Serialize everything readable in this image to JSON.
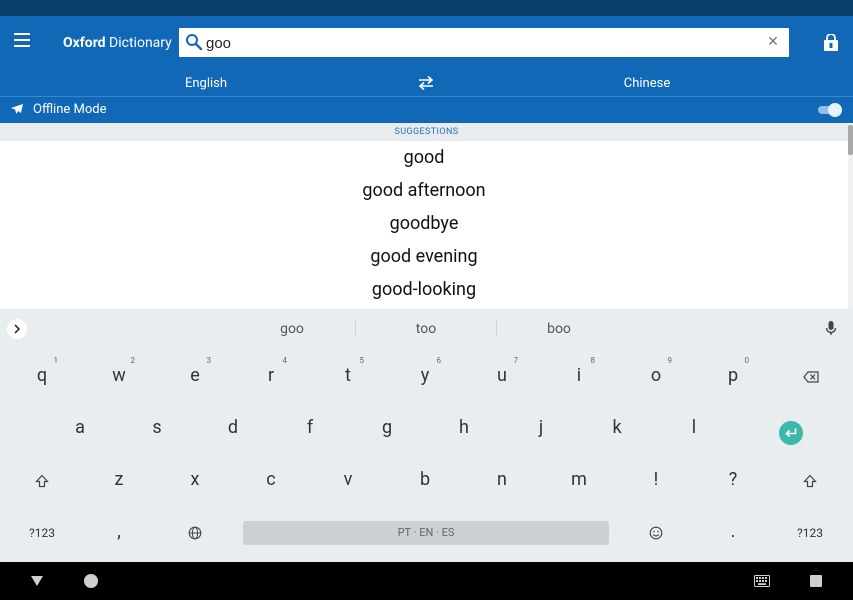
{
  "app": {
    "title_bold": "Oxford",
    "title_rest": " Dictionary"
  },
  "search": {
    "value": "goo",
    "placeholder": ""
  },
  "languages": {
    "source": "English",
    "target": "Chinese"
  },
  "offline": {
    "label": "Offline Mode",
    "enabled": true
  },
  "suggestions": {
    "header": "SUGGESTIONS",
    "items": [
      "good",
      "good afternoon",
      "goodbye",
      "good evening",
      "good-looking"
    ]
  },
  "keyboard": {
    "word_suggestions": [
      "goo",
      "too",
      "boo"
    ],
    "row1": [
      {
        "key": "q",
        "hint": "1"
      },
      {
        "key": "w",
        "hint": "2"
      },
      {
        "key": "e",
        "hint": "3"
      },
      {
        "key": "r",
        "hint": "4"
      },
      {
        "key": "t",
        "hint": "5"
      },
      {
        "key": "y",
        "hint": "6"
      },
      {
        "key": "u",
        "hint": "7"
      },
      {
        "key": "i",
        "hint": "8"
      },
      {
        "key": "o",
        "hint": "9"
      },
      {
        "key": "p",
        "hint": "0"
      }
    ],
    "row2": [
      "a",
      "s",
      "d",
      "f",
      "g",
      "h",
      "j",
      "k",
      "l"
    ],
    "row3": [
      "z",
      "x",
      "c",
      "v",
      "b",
      "n",
      "m",
      "!",
      "?"
    ],
    "symbols_label": "?123",
    "comma": ",",
    "period": ".",
    "space_label": "PT · EN · ES"
  },
  "colors": {
    "app_bar": "#1068b7",
    "status_bar": "#0b3f6b",
    "accent_enter": "#3eb8a8",
    "keyboard_bg": "#e8edf0"
  }
}
